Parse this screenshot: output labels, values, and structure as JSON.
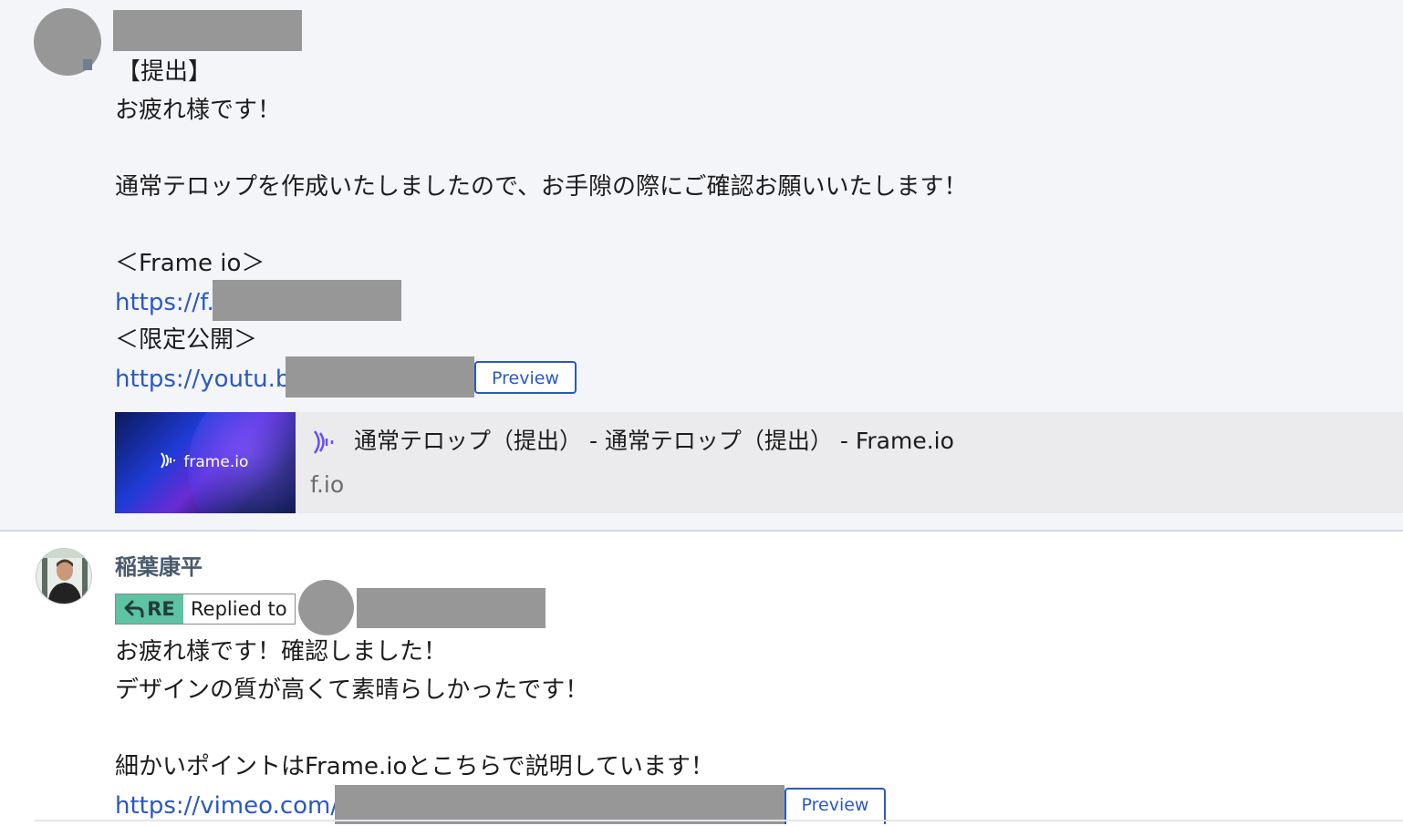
{
  "thread": {
    "message1": {
      "lines": [
        "【提出】",
        "お疲れ様です！",
        "通常テロップを作成いたしましたので、お手隙の際にご確認お願いいたします！",
        "＜Frame io＞",
        "＜限定公開＞"
      ],
      "link1_text": "https://f.",
      "link2_text": "https://youtu.b",
      "preview_label": "Preview",
      "card": {
        "brand": "frame.io",
        "title": "通常テロップ（提出） - 通常テロップ（提出） - Frame.io",
        "domain": "f.io"
      }
    },
    "message2": {
      "author": "稲葉康平",
      "re_label": "RE",
      "replied_to": "Replied to",
      "lines": [
        "お疲れ様です！確認しました！",
        "デザインの質が高くて素晴らしかったです！",
        "細かいポイントはFrame.ioとこちらで説明しています！"
      ],
      "link_text": "https://vimeo.com/",
      "preview_label": "Preview"
    }
  },
  "colors": {
    "link": "#2b58c1",
    "redaction": "#979797",
    "re_tag": "#5dc3a2",
    "message_bg": "#f4f5f9"
  }
}
